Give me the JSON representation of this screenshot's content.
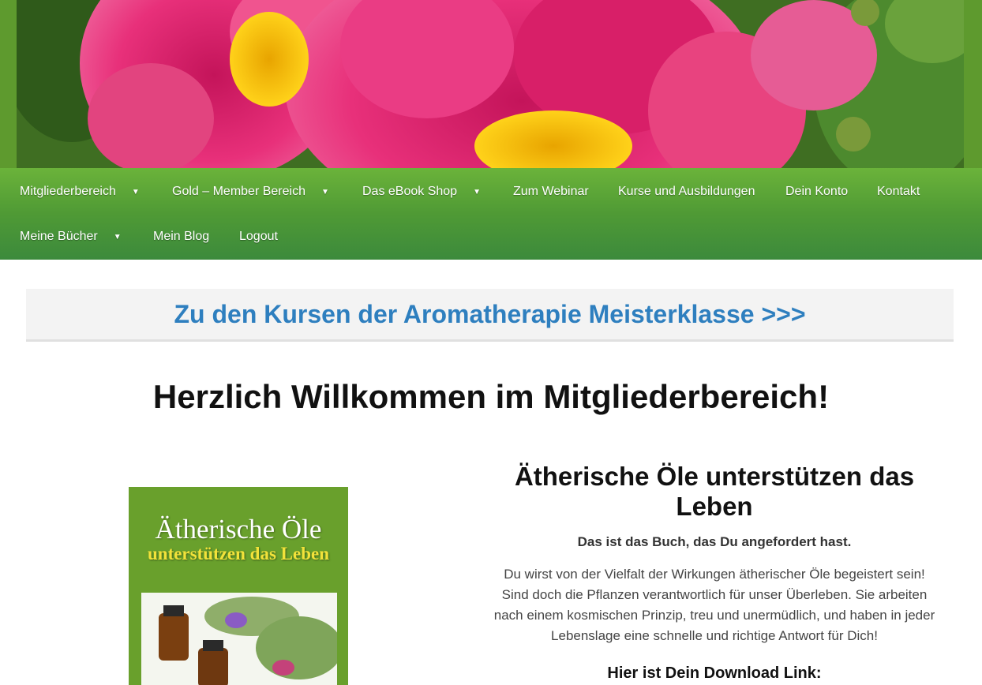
{
  "nav": {
    "items": [
      {
        "label": "Mitgliederbereich",
        "dropdown": true
      },
      {
        "label": "Gold – Member Bereich",
        "dropdown": true
      },
      {
        "label": "Das eBook Shop",
        "dropdown": true
      },
      {
        "label": "Zum Webinar",
        "dropdown": false
      },
      {
        "label": "Kurse und Ausbildungen",
        "dropdown": false
      },
      {
        "label": "Dein Konto",
        "dropdown": false
      },
      {
        "label": "Kontakt",
        "dropdown": false
      },
      {
        "label": "Meine Bücher",
        "dropdown": true
      },
      {
        "label": "Mein Blog",
        "dropdown": false
      },
      {
        "label": "Logout",
        "dropdown": false
      }
    ],
    "caret": "▼"
  },
  "banner": {
    "link_text": "Zu den Kursen der Aromatherapie Meisterklasse >>>"
  },
  "welcome": {
    "heading": "Herzlich Willkommen im Mitgliederbereich!"
  },
  "book": {
    "cover_title": "Ätherische Öle",
    "cover_subtitle": "unterstützen das Leben"
  },
  "content": {
    "title": "Ätherische Öle unterstützen das Leben",
    "subtitle": "Das ist das Buch, das Du angefordert hast.",
    "text": "Du wirst von der Vielfalt der Wirkungen ätherischer Öle begeistert sein! Sind doch die Pflanzen verantwortlich für unser Überleben. Sie arbeiten nach einem kosmischen Prinzip, treu und unermüdlich, und haben in jeder Lebenslage eine schnelle und richtige Antwort für Dich!",
    "download_heading": "Hier ist Dein Download Link:"
  },
  "colors": {
    "nav_green": "#4f9a35",
    "link_blue": "#2e7fbf",
    "flower_pink": "#e0246e",
    "cover_green": "#69a02c"
  }
}
